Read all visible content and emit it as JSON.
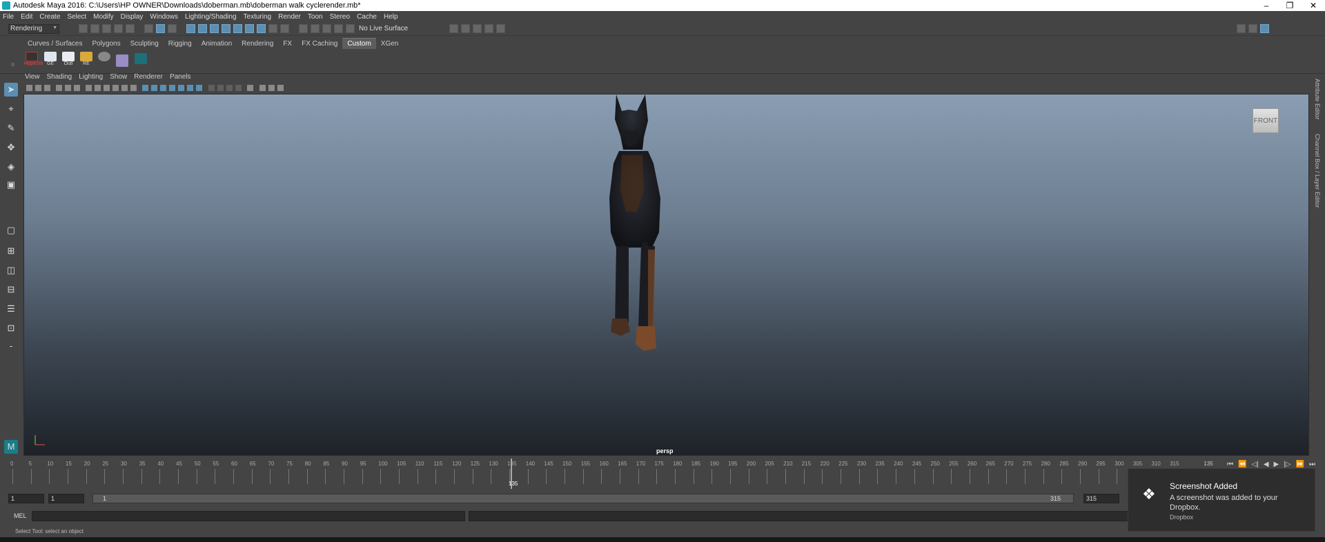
{
  "window": {
    "title": "Autodesk Maya 2016: C:\\Users\\HP OWNER\\Downloads\\doberman.mb\\doberman walk cyclerender.mb*"
  },
  "menubar": [
    "File",
    "Edit",
    "Create",
    "Select",
    "Modify",
    "Display",
    "Windows",
    "Lighting/Shading",
    "Texturing",
    "Render",
    "Toon",
    "Stereo",
    "Cache",
    "Help"
  ],
  "statusline": {
    "mode": "Rendering",
    "live_surface": "No Live Surface"
  },
  "shelf_tabs": [
    "Curves / Surfaces",
    "Polygons",
    "Sculpting",
    "Rigging",
    "Animation",
    "Rendering",
    "FX",
    "FX Caching",
    "Custom",
    "XGen"
  ],
  "shelf_tab_active": "Custom",
  "shelf_buttons": [
    {
      "label": "HyperSh",
      "icon": "hypershade-icon"
    },
    {
      "label": "GE",
      "icon": "graph-editor-icon"
    },
    {
      "label": "Outl",
      "icon": "outliner-icon"
    },
    {
      "label": "RE",
      "icon": "folder-icon"
    },
    {
      "label": "",
      "icon": "render-view-icon"
    },
    {
      "label": "",
      "icon": "render-settings-icon"
    },
    {
      "label": "",
      "icon": "maya-logo-icon"
    }
  ],
  "panel_menu": [
    "View",
    "Shading",
    "Lighting",
    "Show",
    "Renderer",
    "Panels"
  ],
  "viewport": {
    "view_cube": "FRONT",
    "camera": "persp"
  },
  "right_tabs": [
    "Attribute Editor",
    "Channel Box / Layer Editor"
  ],
  "timeline": {
    "ticks": [
      "0",
      "5",
      "10",
      "15",
      "20",
      "25",
      "30",
      "35",
      "40",
      "45",
      "50",
      "55",
      "60",
      "65",
      "70",
      "75",
      "80",
      "85",
      "90",
      "95",
      "100",
      "105",
      "110",
      "115",
      "120",
      "125",
      "130",
      "135",
      "140",
      "145",
      "150",
      "155",
      "160",
      "165",
      "170",
      "175",
      "180",
      "185",
      "190",
      "195",
      "200",
      "205",
      "210",
      "215",
      "220",
      "225",
      "230",
      "235",
      "240",
      "245",
      "250",
      "255",
      "260",
      "265",
      "270",
      "275",
      "280",
      "285",
      "290",
      "295",
      "300",
      "305",
      "310",
      "315"
    ],
    "current_frame": "135",
    "current_frame_field": "135"
  },
  "range": {
    "start": "1",
    "start_anim": "1",
    "range_start": "1",
    "range_end": "315",
    "end_field": "315"
  },
  "cmdline": {
    "lang": "MEL"
  },
  "helpline": "Select Tool: select an object",
  "toast": {
    "title": "Screenshot Added",
    "body": "A screenshot was added to your Dropbox.",
    "app": "Dropbox"
  }
}
